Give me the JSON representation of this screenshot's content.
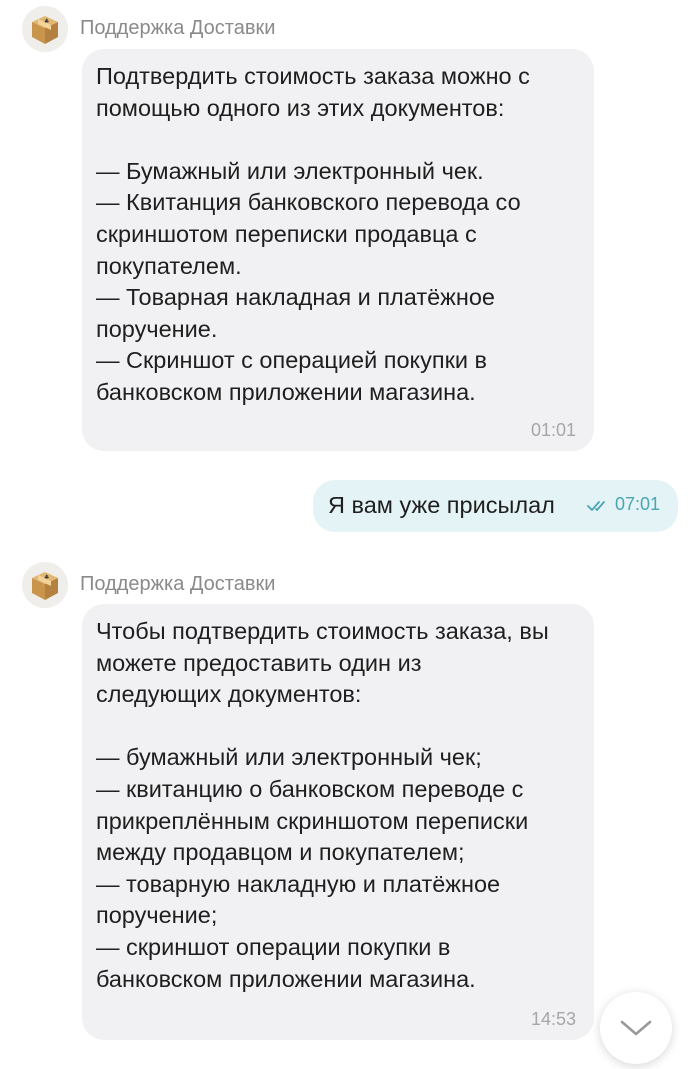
{
  "messages": [
    {
      "sender": "Поддержка Доставки",
      "text": "Подтвердить стоимость заказа можно с\nпомощью одного из этих документов:\n\n— Бумажный или электронный чек.\n— Квитанция банковского перевода со\nскриншотом переписки продавца с\nпокупателем.\n— Товарная накладная и платёжное\nпоручение.\n— Скриншот с операцией покупки в\nбанковском приложении магазина.",
      "time": "01:01"
    },
    {
      "text": "Я вам уже присылал",
      "time": "07:01",
      "status_icon": "double-check-icon"
    },
    {
      "sender": "Поддержка Доставки",
      "text": "Чтобы подтвердить стоимость заказа, вы\nможете предоставить один из\nследующих документов:\n\n— бумажный или электронный чек;\n— квитанцию о банковском переводе с\nприкреплённым скриншотом переписки\nмежду продавцом и покупателем;\n— товарную накладную и платёжное\nпоручение;\n— скриншот операции покупки в\nбанковском приложении магазина.",
      "time": "14:53"
    }
  ],
  "icons": {
    "avatar": "box-avatar-icon",
    "read_status": "double-check-icon",
    "scroll_down": "chevron-down-icon"
  },
  "colors": {
    "incoming_bubble": "#f1f1f3",
    "outgoing_bubble": "#e4f3f5",
    "outgoing_accent": "#4aa5b3",
    "sender_name": "#8a8a8a",
    "timestamp": "#a6a6a6"
  }
}
